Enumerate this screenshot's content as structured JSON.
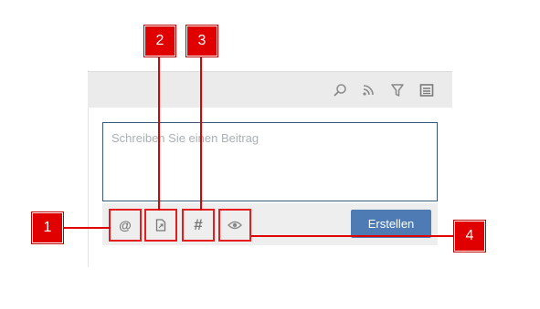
{
  "composer": {
    "placeholder": "Schreiben Sie einen Beitrag"
  },
  "toolbar": {
    "icons": [
      "search-icon",
      "rss-icon",
      "filter-icon",
      "list-icon"
    ]
  },
  "actions": {
    "mention_symbol": "@",
    "attach_icon": "attachment-icon",
    "hashtag_symbol": "#",
    "visibility_icon": "eye-icon",
    "create_label": "Erstellen"
  },
  "callouts": [
    "1",
    "2",
    "3",
    "4"
  ],
  "colors": {
    "highlight": "#e41e1e",
    "callout_bg": "#e00000",
    "create_button": "#4f7bb4",
    "toolbar_bg": "#ebebeb",
    "composer_border": "#3d5a73"
  }
}
